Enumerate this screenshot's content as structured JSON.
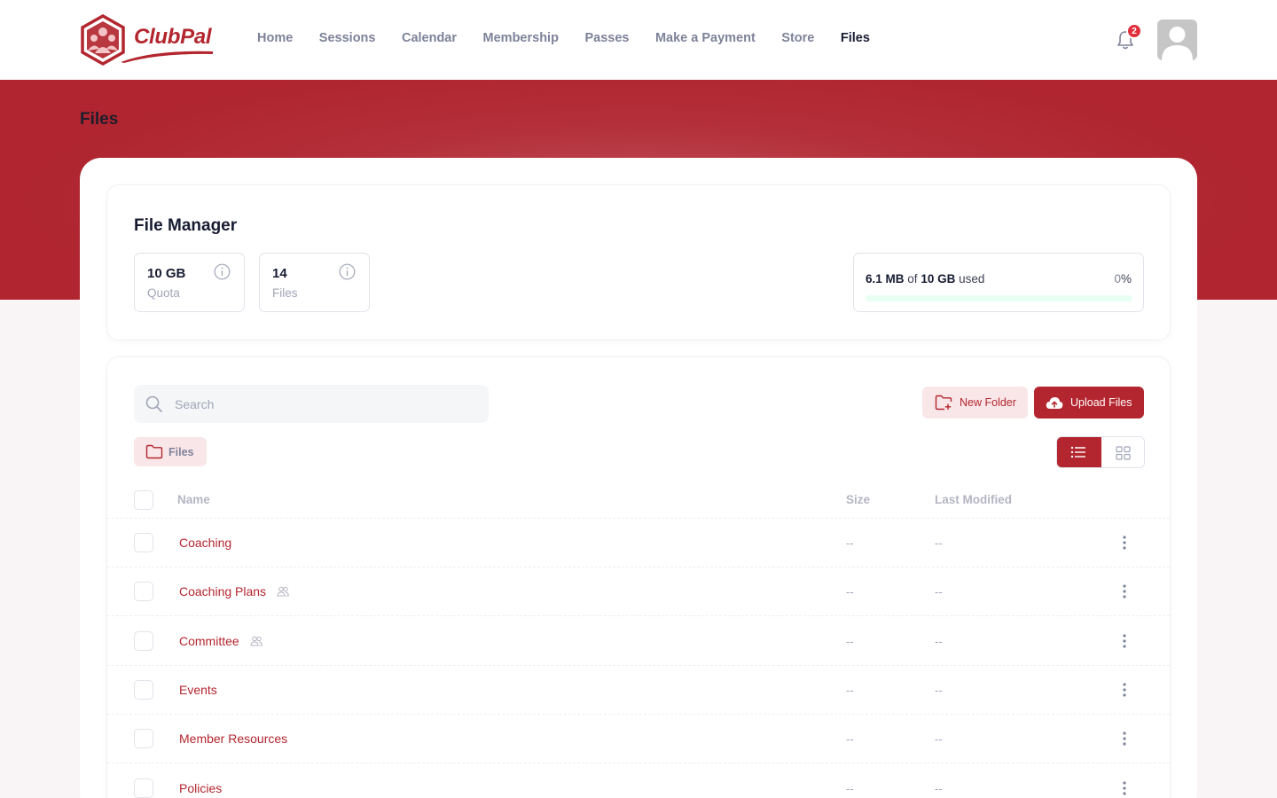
{
  "brand": {
    "name": "ClubPal",
    "color": "#b3262f"
  },
  "nav": {
    "items": [
      {
        "label": "Home",
        "active": false
      },
      {
        "label": "Sessions",
        "active": false
      },
      {
        "label": "Calendar",
        "active": false
      },
      {
        "label": "Membership",
        "active": false
      },
      {
        "label": "Passes",
        "active": false
      },
      {
        "label": "Make a Payment",
        "active": false
      },
      {
        "label": "Store",
        "active": false
      },
      {
        "label": "Files",
        "active": true
      }
    ],
    "notification_count": "2",
    "icons": {
      "bell": "bell-icon",
      "avatar": "user-avatar"
    }
  },
  "page": {
    "title": "Files"
  },
  "file_manager": {
    "title": "File Manager",
    "stats": [
      {
        "value": "10 GB",
        "label": "Quota"
      },
      {
        "value": "14",
        "label": "Files"
      }
    ],
    "usage": {
      "used": "6.1 MB",
      "of_text": "of",
      "total": "10 GB",
      "used_text": "used",
      "percent_value": "0",
      "percent_sign": "%",
      "fraction": 0
    }
  },
  "toolbar": {
    "search_placeholder": "Search",
    "new_folder_label": "New Folder",
    "upload_label": "Upload Files",
    "breadcrumb": "Files",
    "view_mode": "list"
  },
  "table": {
    "columns": {
      "name": "Name",
      "size": "Size",
      "modified": "Last Modified"
    },
    "rows": [
      {
        "name": "Coaching",
        "shared": false,
        "size": "--",
        "modified": "--"
      },
      {
        "name": "Coaching Plans",
        "shared": true,
        "size": "--",
        "modified": "--"
      },
      {
        "name": "Committee",
        "shared": true,
        "size": "--",
        "modified": "--"
      },
      {
        "name": "Events",
        "shared": false,
        "size": "--",
        "modified": "--"
      },
      {
        "name": "Member Resources",
        "shared": false,
        "size": "--",
        "modified": "--"
      },
      {
        "name": "Policies",
        "shared": false,
        "size": "--",
        "modified": "--"
      }
    ]
  }
}
